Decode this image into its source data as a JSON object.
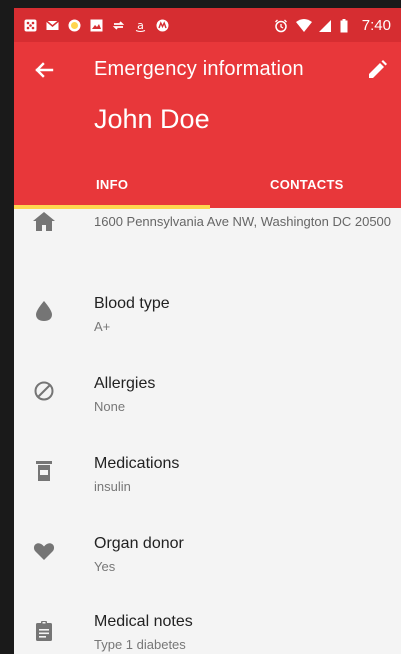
{
  "status_bar": {
    "time": "7:40",
    "left_icons": [
      "notification-icon",
      "gmail-icon",
      "message-icon",
      "photo-icon",
      "sync-icon",
      "amazon-icon",
      "motorola-icon"
    ],
    "right_icons": [
      "alarm-icon",
      "wifi-icon",
      "signal-icon",
      "battery-icon"
    ]
  },
  "toolbar": {
    "title": "Emergency information",
    "back_icon": "arrow-back-icon",
    "edit_icon": "pencil-icon"
  },
  "person": {
    "name": "John Doe"
  },
  "tabs": [
    {
      "label": "INFO",
      "selected": true
    },
    {
      "label": "CONTACTS",
      "selected": false
    }
  ],
  "accent_color": "#e8373a",
  "tab_indicator_color": "#ffd54f",
  "info": {
    "address": {
      "icon": "home-icon",
      "value": "1600 Pennsylvania Ave NW, Washington DC 20500"
    },
    "blood_type": {
      "icon": "drop-icon",
      "label": "Blood type",
      "value": "A+"
    },
    "allergies": {
      "icon": "block-icon",
      "label": "Allergies",
      "value": "None"
    },
    "medications": {
      "icon": "pill-bottle-icon",
      "label": "Medications",
      "value": "insulin"
    },
    "organ_donor": {
      "icon": "heart-icon",
      "label": "Organ donor",
      "value": "Yes"
    },
    "medical_notes": {
      "icon": "clipboard-icon",
      "label": "Medical notes",
      "value": "Type 1 diabetes"
    }
  }
}
